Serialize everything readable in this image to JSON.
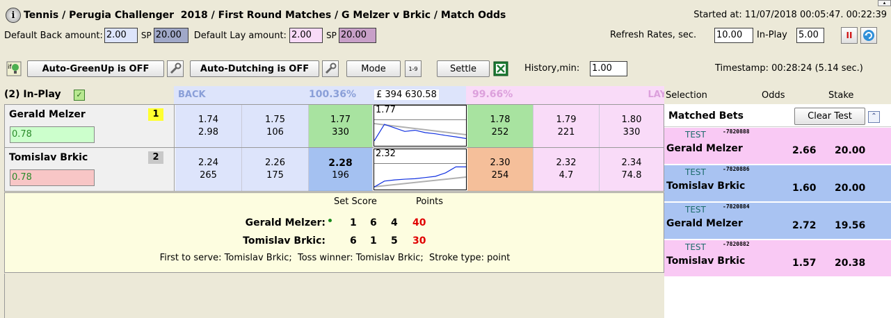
{
  "header": {
    "breadcrumb": "Tennis / Perugia Challenger  2018 / First Round Matches / G Melzer v Brkic / Match Odds",
    "started_at": "Started at: 11/07/2018 00:05:47. 00:22:39"
  },
  "settings": {
    "default_back_label": "Default Back amount:",
    "default_back_value": "2.00",
    "sp_label": "SP",
    "back_sp_value": "20.00",
    "default_lay_label": "Default Lay amount:",
    "default_lay_value": "2.00",
    "lay_sp_value": "20.00",
    "refresh_label": "Refresh Rates, sec.",
    "refresh_value": "10.00",
    "inplay_label": "In-Play",
    "inplay_value": "5.00"
  },
  "toolbar": {
    "auto_greenup": "Auto-GreenUp is OFF",
    "auto_dutching": "Auto-Dutching is OFF",
    "mode": "Mode",
    "settle": "Settle",
    "history_label": "History,min:",
    "history_value": "1.00",
    "timestamp": "Timestamp: 00:28:24 (5.14 sec.)"
  },
  "market": {
    "status": "(2) In-Play",
    "back_label": "BACK",
    "back_pct": "100.36%",
    "matched": "£ 394 630.58",
    "lay_pct": "99.66%",
    "lay_label": "LAY",
    "runners": [
      {
        "name": "Gerald Melzer",
        "number": "1",
        "pl": "0.78",
        "back": [
          [
            "1.74",
            "2.98"
          ],
          [
            "1.75",
            "106"
          ],
          [
            "1.77",
            "330"
          ]
        ],
        "last": "1.77",
        "lay": [
          [
            "1.78",
            "252"
          ],
          [
            "1.79",
            "221"
          ],
          [
            "1.80",
            "330"
          ]
        ],
        "trend": [
          0.85,
          0.15,
          0.3,
          0.45,
          0.4,
          0.5,
          0.55,
          0.62,
          0.68,
          0.75
        ]
      },
      {
        "name": "Tomislav Brkic",
        "number": "2",
        "pl": "0.78",
        "back": [
          [
            "2.24",
            "265"
          ],
          [
            "2.26",
            "175"
          ],
          [
            "2.28",
            "196"
          ]
        ],
        "last": "2.32",
        "lay": [
          [
            "2.30",
            "254"
          ],
          [
            "2.32",
            "4.7"
          ],
          [
            "2.34",
            "74.8"
          ]
        ],
        "trend": [
          0.95,
          0.7,
          0.65,
          0.62,
          0.6,
          0.55,
          0.5,
          0.35,
          0.1,
          0.1
        ]
      }
    ]
  },
  "score": {
    "set_score_label": "Set Score",
    "points_label": "Points",
    "players": [
      {
        "name": "Gerald Melzer:",
        "sets": [
          "1",
          "6",
          "4"
        ],
        "points": "40",
        "serving": true
      },
      {
        "name": "Tomislav Brkic:",
        "sets": [
          "6",
          "1",
          "5"
        ],
        "points": "30",
        "serving": false
      }
    ],
    "info": "First to serve: Tomislav Brkic;  Toss winner: Tomislav Brkic;  Stroke type: point"
  },
  "bets_panel": {
    "col_selection": "Selection",
    "col_odds": "Odds",
    "col_stake": "Stake",
    "title": "Matched Bets",
    "clear_button": "Clear Test",
    "bets": [
      {
        "tag": "TEST",
        "ref": "-7820888",
        "selection": "Gerald Melzer",
        "odds": "2.66",
        "stake": "20.00",
        "side": "lay"
      },
      {
        "tag": "TEST",
        "ref": "-7820886",
        "selection": "Tomislav Brkic",
        "odds": "1.60",
        "stake": "20.00",
        "side": "back"
      },
      {
        "tag": "TEST",
        "ref": "-7820884",
        "selection": "Gerald Melzer",
        "odds": "2.72",
        "stake": "19.56",
        "side": "back"
      },
      {
        "tag": "TEST",
        "ref": "-7820882",
        "selection": "Tomislav Brkic",
        "odds": "1.57",
        "stake": "20.38",
        "side": "lay"
      }
    ]
  },
  "colors": {
    "back": "#dde4fb",
    "back_best": "#a4c1f1",
    "back_best_green": "#a8e3a0",
    "lay": "#f9dbf8",
    "lay_best_green": "#a8e3a0",
    "lay_best_orange": "#f5bf9a",
    "score_bg": "#fdfde0",
    "pl_green": "#ccffcc",
    "pl_red": "#f8c6c6"
  }
}
